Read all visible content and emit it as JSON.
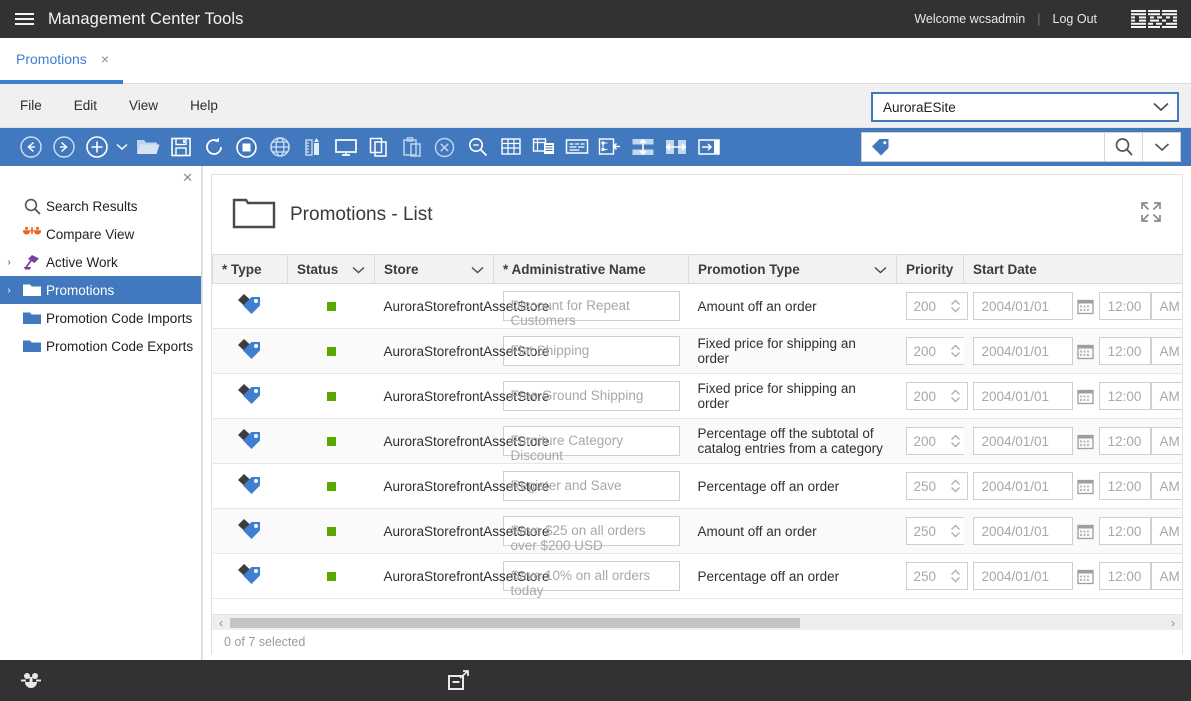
{
  "header": {
    "menu_icon": "hamburger-icon",
    "title": "Management Center Tools",
    "welcome": "Welcome wcsadmin",
    "separator": "|",
    "logout": "Log Out",
    "brand": "IBM"
  },
  "tabs": [
    {
      "label": "Promotions",
      "close": "×",
      "active": true
    }
  ],
  "menubar": {
    "items": [
      {
        "label": "File"
      },
      {
        "label": "Edit"
      },
      {
        "label": "View"
      },
      {
        "label": "Help"
      }
    ],
    "store_selector": {
      "value": "AuroraESite",
      "chevron": "chevron-down-icon"
    }
  },
  "toolbar": {
    "buttons": [
      {
        "name": "back-icon",
        "title": "Back"
      },
      {
        "name": "forward-icon",
        "title": "Forward"
      },
      {
        "name": "new-icon",
        "title": "New"
      },
      {
        "name": "new-dropdown-caret-icon",
        "title": "New options"
      },
      {
        "name": "open-folder-icon",
        "title": "Open"
      },
      {
        "name": "save-icon",
        "title": "Save"
      },
      {
        "name": "refresh-icon",
        "title": "Refresh"
      },
      {
        "name": "stop-icon",
        "title": "Stop"
      },
      {
        "name": "globe-icon",
        "title": "Globe"
      },
      {
        "name": "ruler-icon",
        "title": "Manage"
      },
      {
        "name": "monitor-icon",
        "title": "Preview"
      },
      {
        "name": "copy-icon",
        "title": "Copy"
      },
      {
        "name": "paste-icon",
        "title": "Paste"
      },
      {
        "name": "delete-icon",
        "title": "Delete"
      },
      {
        "name": "find-icon",
        "title": "Find"
      },
      {
        "name": "table-icon",
        "title": "Table"
      },
      {
        "name": "list-detail-icon",
        "title": "List and details"
      },
      {
        "name": "properties-icon",
        "title": "Properties"
      },
      {
        "name": "tree-collapse-icon",
        "title": "Tree"
      },
      {
        "name": "expand-vertical-icon",
        "title": "Expand vertically"
      },
      {
        "name": "expand-horizontal-icon",
        "title": "Expand horizontally"
      },
      {
        "name": "show-panel-icon",
        "title": "Show panel"
      }
    ],
    "search": {
      "tag_icon": "tag-icon",
      "value": "",
      "placeholder": "",
      "search_icon": "search-icon",
      "dropdown_icon": "chevron-down-icon"
    }
  },
  "sidebar": {
    "close_icon": "close-icon",
    "items": [
      {
        "label": "Search Results",
        "icon": "search-icon",
        "twisty": false,
        "selected": false
      },
      {
        "label": "Compare View",
        "icon": "compare-scales-icon",
        "twisty": false,
        "selected": false
      },
      {
        "label": "Active Work",
        "icon": "active-work-lamp-icon",
        "twisty": true,
        "selected": false
      },
      {
        "label": "Promotions",
        "icon": "folder-icon",
        "twisty": true,
        "selected": true
      },
      {
        "label": "Promotion Code Imports",
        "icon": "folder-icon",
        "twisty": false,
        "selected": false
      },
      {
        "label": "Promotion Code Exports",
        "icon": "folder-icon",
        "twisty": false,
        "selected": false
      }
    ]
  },
  "main": {
    "folder_icon": "folder-outline-icon",
    "page_title": "Promotions - List",
    "expand_icon": "expand-fullscreen-icon",
    "columns": [
      {
        "label": "* Type",
        "chevron": false
      },
      {
        "label": "Status",
        "chevron": true
      },
      {
        "label": "Store",
        "chevron": true
      },
      {
        "label": "* Administrative Name",
        "chevron": false
      },
      {
        "label": "Promotion Type",
        "chevron": true
      },
      {
        "label": "Priority",
        "chevron": false
      },
      {
        "label": "Start Date",
        "chevron": false
      }
    ],
    "rows": [
      {
        "type_icon": "promotion-tag-icon",
        "status": "active",
        "store": "AuroraStorefrontAssetStore",
        "admin_name": "Discount for Repeat Customers",
        "promotion_type": "Amount off an order",
        "priority": "200",
        "start_date": "2004/01/01",
        "start_time": "12:00",
        "meridiem": "AM"
      },
      {
        "type_icon": "promotion-tag-icon",
        "status": "active",
        "store": "AuroraStorefrontAssetStore",
        "admin_name": "Flat Shipping",
        "promotion_type": "Fixed price for shipping an order",
        "priority": "200",
        "start_date": "2004/01/01",
        "start_time": "12:00",
        "meridiem": "AM"
      },
      {
        "type_icon": "promotion-tag-icon",
        "status": "active",
        "store": "AuroraStorefrontAssetStore",
        "admin_name": "Free Ground Shipping",
        "promotion_type": "Fixed price for shipping an order",
        "priority": "200",
        "start_date": "2004/01/01",
        "start_time": "12:00",
        "meridiem": "AM"
      },
      {
        "type_icon": "promotion-tag-icon",
        "status": "active",
        "store": "AuroraStorefrontAssetStore",
        "admin_name": "Furniture Category Discount",
        "promotion_type": "Percentage off the subtotal of catalog entries from a category",
        "priority": "200",
        "start_date": "2004/01/01",
        "start_time": "12:00",
        "meridiem": "AM"
      },
      {
        "type_icon": "promotion-tag-icon",
        "status": "active",
        "store": "AuroraStorefrontAssetStore",
        "admin_name": "Register and Save",
        "promotion_type": "Percentage off an order",
        "priority": "250",
        "start_date": "2004/01/01",
        "start_time": "12:00",
        "meridiem": "AM"
      },
      {
        "type_icon": "promotion-tag-icon",
        "status": "active",
        "store": "AuroraStorefrontAssetStore",
        "admin_name": "Save $25 on all orders over $200 USD",
        "promotion_type": "Amount off an order",
        "priority": "250",
        "start_date": "2004/01/01",
        "start_time": "12:00",
        "meridiem": "AM"
      },
      {
        "type_icon": "promotion-tag-icon",
        "status": "active",
        "store": "AuroraStorefrontAssetStore",
        "admin_name": "Save 10% on all orders today",
        "promotion_type": "Percentage off an order",
        "priority": "250",
        "start_date": "2004/01/01",
        "start_time": "12:00",
        "meridiem": "AM"
      }
    ],
    "scroll": {
      "left_arrow": "‹",
      "right_arrow": "›"
    },
    "selection_status": "0 of 7 selected"
  },
  "footer": {
    "bug_icon": "bug-icon",
    "restore_icon": "restore-window-icon"
  },
  "colors": {
    "topbar": "#323232",
    "accent_blue": "#4178be",
    "tab_blue": "#3f7fd1",
    "status_green": "#5aa700",
    "folder_blue": "#4178be"
  }
}
